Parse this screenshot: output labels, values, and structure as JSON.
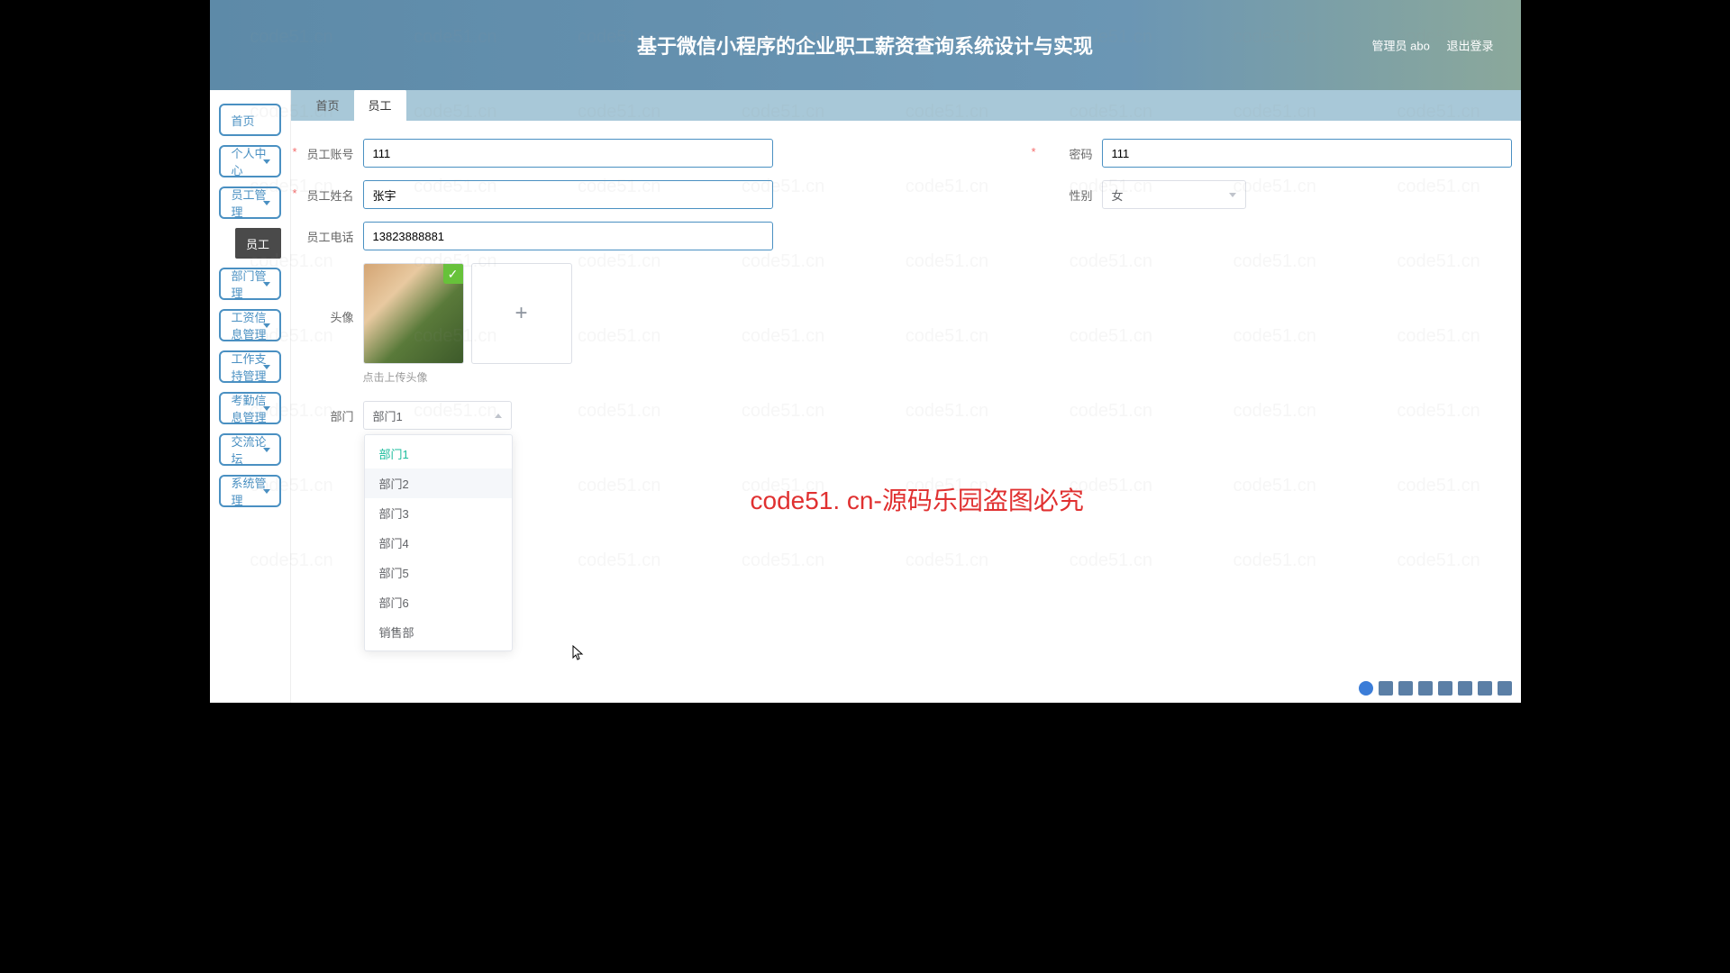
{
  "header": {
    "title": "基于微信小程序的企业职工薪资查询系统设计与实现",
    "admin_label": "管理员 abo",
    "logout_label": "退出登录"
  },
  "sidebar": {
    "items": [
      {
        "label": "首页",
        "expandable": false
      },
      {
        "label": "个人中心",
        "expandable": true
      },
      {
        "label": "员工管理",
        "expandable": true
      },
      {
        "label": "部门管理",
        "expandable": true
      },
      {
        "label": "工资信息管理",
        "expandable": true
      },
      {
        "label": "工作支持管理",
        "expandable": true
      },
      {
        "label": "考勤信息管理",
        "expandable": true
      },
      {
        "label": "交流论坛",
        "expandable": true
      },
      {
        "label": "系统管理",
        "expandable": true
      }
    ],
    "submenu_label": "员工"
  },
  "tabs": [
    {
      "label": "首页",
      "active": false
    },
    {
      "label": "员工",
      "active": true
    }
  ],
  "form": {
    "emp_account_label": "员工账号",
    "emp_account_value": "111",
    "password_label": "密码",
    "password_value": "111",
    "emp_name_label": "员工姓名",
    "emp_name_value": "张宇",
    "gender_label": "性别",
    "gender_value": "女",
    "phone_label": "员工电话",
    "phone_value": "13823888881",
    "avatar_label": "头像",
    "avatar_hint": "点击上传头像",
    "dept_label": "部门",
    "dept_value": "部门1",
    "dept_options": [
      "部门1",
      "部门2",
      "部门3",
      "部门4",
      "部门5",
      "部门6",
      "销售部"
    ]
  },
  "watermark": "code51.cn",
  "red_watermark": "code51. cn-源码乐园盗图必究"
}
